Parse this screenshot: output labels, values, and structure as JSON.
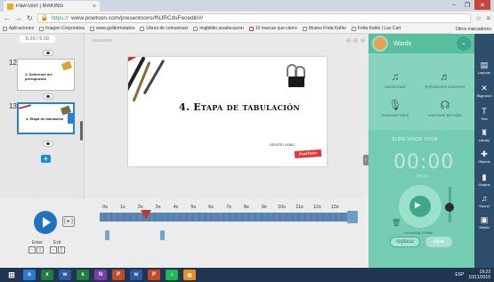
{
  "browser": {
    "tab_title": "PawToon | MAKING",
    "url_protocol": "https://",
    "url_rest": "www.powtoon.com/presentoons/fNJRCdsFecedit/#/",
    "bookmarks": [
      "Aplicaciones",
      "Imagen Corporativa",
      "www.guillermotatoo",
      "Libros de comunicaci",
      "imgbiblio.unaducacion",
      "10 marcas que cierro",
      "Museo Frida Kahlo",
      "Frida Kahlo | Las Cart"
    ],
    "bookmarks_right": "Otros marcadores"
  },
  "slides": {
    "counter": "5:20 / 5:20",
    "items": [
      {
        "number": "12",
        "title": "3. Definición del presupuesto"
      },
      {
        "number": "13",
        "title": "4. Etapa de tabulación"
      }
    ],
    "add_label": "+"
  },
  "canvas": {
    "title": "4. Etapa de tabulación",
    "logo_text": "PowToon",
    "stamp_text": "CREATED USING"
  },
  "audio_panel": {
    "title": "Words",
    "options": [
      {
        "icon": "♫",
        "label": "sound track"
      },
      {
        "icon": "♬",
        "label": "professional voiceover"
      },
      {
        "icon": "🎙",
        "label": "voiceover track"
      },
      {
        "icon": "☊",
        "label": "voiceover per slide"
      }
    ],
    "slide_voice_label": "SLIDE VOICE OVER",
    "timer": "00:00",
    "timer_sub": "00:14",
    "recording_label": "Recording 10 files",
    "replace_label": "replace",
    "save_label": "save",
    "close_icon": "close-icon"
  },
  "tools": [
    {
      "icon": "▤",
      "label": "Layouts"
    },
    {
      "icon": "✕",
      "label": "Bkground"
    },
    {
      "icon": "T",
      "label": "Text"
    },
    {
      "icon": "♜",
      "label": "Library"
    },
    {
      "icon": "✚",
      "label": "Objects"
    },
    {
      "icon": "▮",
      "label": "Graphs"
    },
    {
      "icon": "♫",
      "label": "Sound"
    },
    {
      "icon": "▣",
      "label": "Media"
    }
  ],
  "timeline": {
    "enter_label": "Enter",
    "exit_label": "Exit",
    "step_label": "[ ▸ ]",
    "ticks": [
      "0s",
      "1s",
      "2s",
      "3s",
      "4s",
      "5s",
      "6s",
      "7s",
      "8s",
      "9s",
      "10s",
      "11s",
      "12s",
      "13s"
    ],
    "playhead_seconds": 2.6,
    "duration_seconds": 14
  },
  "taskbar": {
    "apps": [
      "e",
      "x",
      "w",
      "x",
      "N",
      "P",
      "w",
      "P",
      "♫",
      "◍"
    ],
    "app_colors": [
      "#2b7bd1",
      "#1f7f3e",
      "#2a5aa8",
      "#1f7f3e",
      "#7a3da6",
      "#c54a2b",
      "#2a5aa8",
      "#c54a2b",
      "#1db954",
      "#e8901f"
    ],
    "language": "ESP",
    "time": "19:23",
    "date": "10/11/2016"
  }
}
